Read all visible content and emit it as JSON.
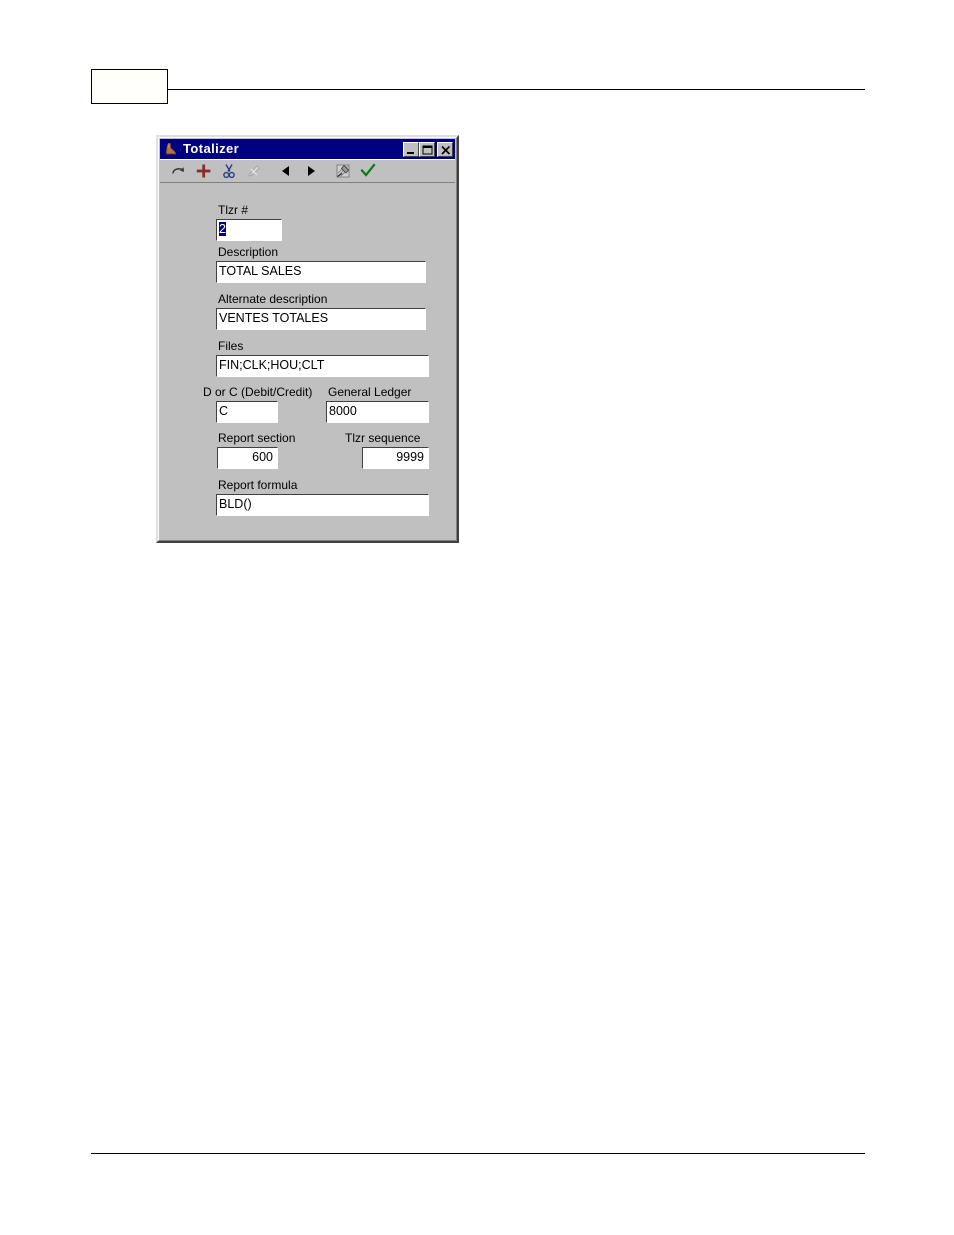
{
  "page": {
    "header_box_label": "",
    "has_header_rule": true,
    "has_footer_rule": true
  },
  "dialog": {
    "title": "Totalizer",
    "title_icon": "boot-icon",
    "titlebar_color": "#000080",
    "background_color": "#C0C0C0",
    "window_buttons": [
      {
        "name": "minimize-button",
        "glyph": "minimize-icon",
        "label": "_"
      },
      {
        "name": "maximize-button",
        "glyph": "maximize-icon",
        "label": "□"
      },
      {
        "name": "close-button",
        "glyph": "close-icon",
        "label": "×"
      }
    ],
    "toolbar": [
      {
        "name": "redo-button",
        "icon": "redo-arrow-icon",
        "enabled": true,
        "color": "#303030"
      },
      {
        "name": "add-button",
        "icon": "plus-icon",
        "enabled": true,
        "color": "#8b2b2b"
      },
      {
        "name": "cut-button",
        "icon": "scissors-icon",
        "enabled": true,
        "color": "#2b3c8b"
      },
      {
        "name": "edit-button",
        "icon": "pencil-icon",
        "enabled": false,
        "color": "#a8a8a8"
      },
      {
        "name": "previous-record-button",
        "icon": "left-triangle-icon",
        "enabled": true,
        "color": "#000000"
      },
      {
        "name": "next-record-button",
        "icon": "right-triangle-icon",
        "enabled": true,
        "color": "#000000"
      },
      {
        "name": "erase-button",
        "icon": "eraser-icon",
        "enabled": true,
        "color": "#555555"
      },
      {
        "name": "confirm-button",
        "icon": "checkmark-icon",
        "enabled": true,
        "color": "#0a7a14"
      }
    ],
    "fields": {
      "tlzr_number": {
        "label": "Tlzr #",
        "value": "2",
        "selected": true
      },
      "description": {
        "label": "Description",
        "value": "TOTAL SALES"
      },
      "alternate_description": {
        "label": "Alternate description",
        "value": "VENTES TOTALES"
      },
      "files": {
        "label": "Files",
        "value": "FIN;CLK;HOU;CLT"
      },
      "debit_credit": {
        "label": "D or C (Debit/Credit)",
        "value": "C"
      },
      "general_ledger": {
        "label": "General Ledger",
        "value": "8000"
      },
      "report_section": {
        "label": "Report section",
        "value": "600"
      },
      "tlzr_sequence": {
        "label": "Tlzr sequence",
        "value": "9999"
      },
      "report_formula": {
        "label": "Report formula",
        "value": "BLD()"
      }
    }
  }
}
